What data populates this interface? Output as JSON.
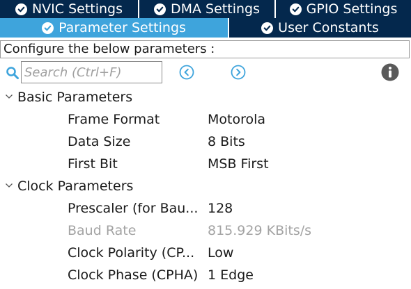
{
  "tabs_row1": [
    {
      "label": "NVIC Settings",
      "active": false
    },
    {
      "label": "DMA Settings",
      "active": false
    },
    {
      "label": "GPIO Settings",
      "active": false
    }
  ],
  "tabs_row2": [
    {
      "label": "Parameter Settings",
      "active": true
    },
    {
      "label": "User Constants",
      "active": false
    }
  ],
  "description": "Configure the below parameters :",
  "search": {
    "placeholder": "Search (Ctrl+F)",
    "value": ""
  },
  "colors": {
    "tab_bg": "#04284d",
    "tab_active_bg": "#3ea4dc",
    "icon_blue": "#3ea4dc",
    "disabled_text": "#a3a3a3"
  },
  "groups": [
    {
      "title": "Basic Parameters",
      "expanded": true,
      "params": [
        {
          "name": "Frame Format",
          "value": "Motorola"
        },
        {
          "name": "Data Size",
          "value": "8 Bits"
        },
        {
          "name": "First Bit",
          "value": "MSB First"
        }
      ]
    },
    {
      "title": "Clock Parameters",
      "expanded": true,
      "params": [
        {
          "name": "Prescaler (for Bau...",
          "value": "128"
        },
        {
          "name": "Baud Rate",
          "value": "815.929 KBits/s",
          "disabled": true
        },
        {
          "name": "Clock Polarity (CP...",
          "value": "Low"
        },
        {
          "name": "Clock Phase (CPHA)",
          "value": "1 Edge"
        }
      ]
    }
  ]
}
